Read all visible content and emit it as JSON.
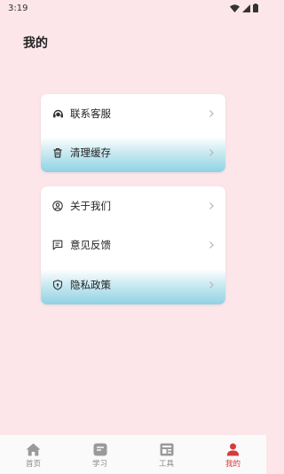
{
  "status_bar": {
    "time": "3:19"
  },
  "page": {
    "title": "我的"
  },
  "cards": [
    {
      "items": [
        {
          "label": "联系客服",
          "icon": "headset-icon"
        },
        {
          "label": "清理缓存",
          "icon": "trash-icon"
        }
      ]
    },
    {
      "items": [
        {
          "label": "关于我们",
          "icon": "user-circle-icon"
        },
        {
          "label": "意见反馈",
          "icon": "feedback-icon"
        },
        {
          "label": "隐私政策",
          "icon": "shield-icon"
        }
      ]
    }
  ],
  "tabbar": {
    "items": [
      {
        "label": "首页",
        "icon": "home-icon"
      },
      {
        "label": "学习",
        "icon": "study-icon"
      },
      {
        "label": "工具",
        "icon": "tools-icon"
      },
      {
        "label": "我的",
        "icon": "person-icon"
      }
    ],
    "active_index": 3
  },
  "colors": {
    "background": "#fce6ea",
    "highlight": "#8fd2e3",
    "active_tab": "#d93a3a",
    "inactive_tab": "#8a8a8a"
  }
}
